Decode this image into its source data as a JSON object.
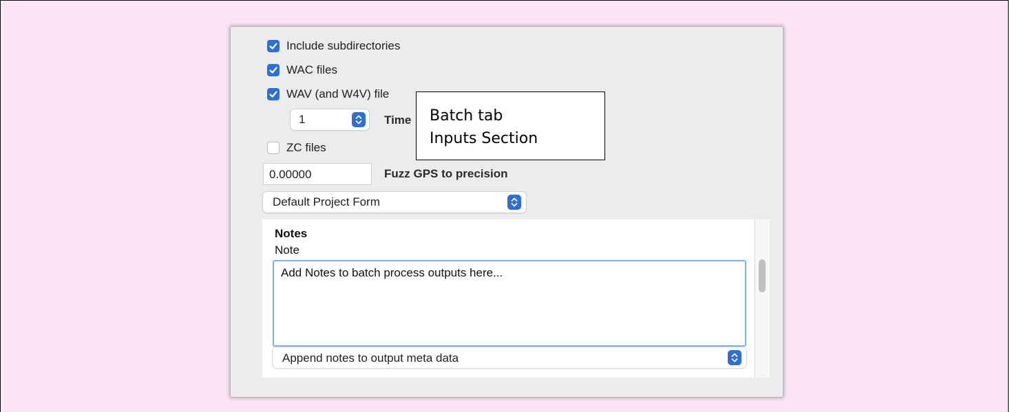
{
  "options": {
    "include_subdirectories": {
      "label": "Include subdirectories",
      "checked": true
    },
    "wac_files": {
      "label": "WAC files",
      "checked": true
    },
    "wav_files": {
      "label": "WAV (and W4V) file",
      "checked": true
    },
    "zc_files": {
      "label": "ZC files",
      "checked": false
    }
  },
  "wav_expansion": {
    "value": "1",
    "label": "Time"
  },
  "fuzz_gps": {
    "value": "0.00000",
    "label": "Fuzz GPS to precision"
  },
  "project_form": {
    "selected": "Default Project Form"
  },
  "notes": {
    "heading": "Notes",
    "field_label": "Note",
    "placeholder": "Add Notes to batch process outputs here..."
  },
  "notes_mode": {
    "selected": "Append notes to output meta data"
  },
  "callout": {
    "line1": "Batch tab",
    "line2": "Inputs Section"
  },
  "colors": {
    "accent": "#2d6fd6",
    "background": "#fbe5f7",
    "panel": "#ececec"
  }
}
